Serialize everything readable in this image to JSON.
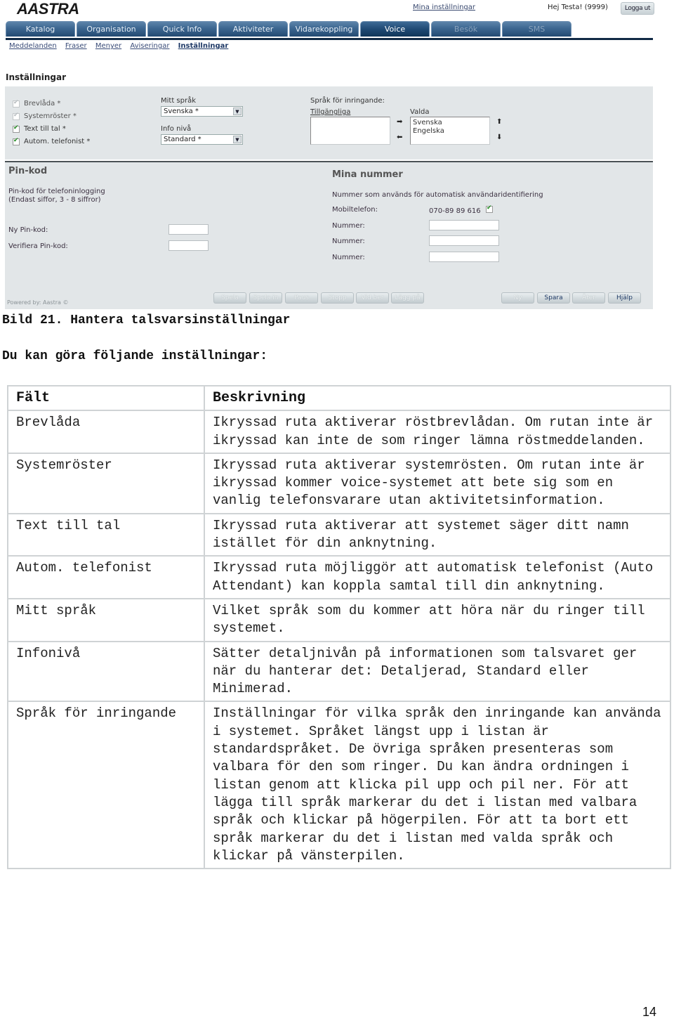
{
  "app": {
    "logo": "AASTRA",
    "top_link": "Mina inställningar",
    "greeting": "Hej Testa! (9999)",
    "logout": "Logga ut"
  },
  "tabs": [
    {
      "label": "Katalog",
      "state": "normal"
    },
    {
      "label": "Organisation",
      "state": "normal"
    },
    {
      "label": "Quick Info",
      "state": "normal"
    },
    {
      "label": "Aktiviteter",
      "state": "normal"
    },
    {
      "label": "Vidarekoppling",
      "state": "normal"
    },
    {
      "label": "Voice",
      "state": "active"
    },
    {
      "label": "Besök",
      "state": "disabled"
    },
    {
      "label": "SMS",
      "state": "disabled"
    }
  ],
  "subnav": [
    {
      "label": "Meddelanden",
      "active": false
    },
    {
      "label": "Fraser",
      "active": false
    },
    {
      "label": "Menyer",
      "active": false
    },
    {
      "label": "Aviseringar",
      "active": false
    },
    {
      "label": "Inställningar",
      "active": true
    }
  ],
  "settings": {
    "title": "Inställningar",
    "checkboxes": [
      {
        "label": "Brevlåda *",
        "checked": true,
        "disabled": true
      },
      {
        "label": "Systemröster *",
        "checked": true,
        "disabled": true
      },
      {
        "label": "Text till tal *",
        "checked": true,
        "disabled": false
      },
      {
        "label": "Autom. telefonist *",
        "checked": true,
        "disabled": false
      }
    ],
    "my_language": {
      "label": "Mitt språk",
      "value": "Svenska *"
    },
    "info_level": {
      "label": "Info nivå",
      "value": "Standard *"
    },
    "caller_languages": {
      "label": "Språk för inringande:",
      "available_label": "Tillgängliga",
      "available": [],
      "selected_label": "Valda",
      "selected": [
        "Svenska",
        "Engelska"
      ]
    }
  },
  "pin": {
    "title": "Pin-kod",
    "desc_line1": "Pin-kod för telefoninlogging",
    "desc_line2": "(Endast siffor, 3 - 8 siffror)",
    "new_label": "Ny Pin-kod:",
    "new_value": "",
    "verify_label": "Verifiera Pin-kod:",
    "verify_value": ""
  },
  "numbers": {
    "title": "Mina nummer",
    "desc": "Nummer som används för automatisk användaridentifiering",
    "mobile_label": "Mobiltelefon:",
    "mobile_value": "070-89 89 616",
    "mobile_checked": true,
    "number_label": "Nummer:",
    "number_values": [
      "",
      "",
      ""
    ]
  },
  "footer": {
    "powered": "Powered by: Aastra ©",
    "player_buttons": [
      "Spela",
      "Spela in",
      "Paus",
      "Stopp",
      "Vid ber",
      "Lägg på"
    ],
    "action_buttons": [
      {
        "label": "Ny",
        "enabled": false
      },
      {
        "label": "Spara",
        "enabled": true
      },
      {
        "label": "Åter",
        "enabled": false
      },
      {
        "label": "Hjälp",
        "enabled": true
      }
    ]
  },
  "doc": {
    "caption": "Bild 21. Hantera talsvarsinställningar",
    "intro": "Du kan göra följande inställningar:",
    "table": {
      "headers": [
        "Fält",
        "Beskrivning"
      ],
      "rows": [
        {
          "field": "Brevlåda",
          "desc": "Ikryssad ruta aktiverar röstbrevlådan. Om rutan inte är ikryssad kan inte de som ringer lämna röstmeddelanden."
        },
        {
          "field": "Systemröster",
          "desc": "Ikryssad ruta aktiverar systemrösten. Om rutan inte är ikryssad kommer voice-systemet att bete sig som en vanlig telefonsvarare utan aktivitetsinformation."
        },
        {
          "field": "Text till tal",
          "desc": "Ikryssad ruta aktiverar att systemet säger ditt namn istället för din anknytning."
        },
        {
          "field": "Autom. telefonist",
          "desc": "Ikryssad ruta möjliggör att automatisk telefonist (Auto Attendant) kan koppla samtal till din anknytning."
        },
        {
          "field": "Mitt språk",
          "desc": "Vilket språk som du kommer att höra när du ringer till systemet."
        },
        {
          "field": "Infonivå",
          "desc": "Sätter detaljnivån på informationen som talsvaret ger när du hanterar det: Detaljerad, Standard eller Minimerad."
        },
        {
          "field": "Språk för inringande",
          "desc": "Inställningar för vilka språk den inringande kan använda i systemet. Språket längst upp i listan är standardspråket. De övriga språken presenteras som valbara för den som ringer. Du kan ändra ordningen i listan genom att klicka pil upp och pil ner. För att lägga till språk markerar du det i listan med valbara språk och klickar på högerpilen. För att ta bort ett språk markerar du det i listan med valda språk och klickar på vänsterpilen."
        }
      ]
    },
    "page_number": "14"
  }
}
